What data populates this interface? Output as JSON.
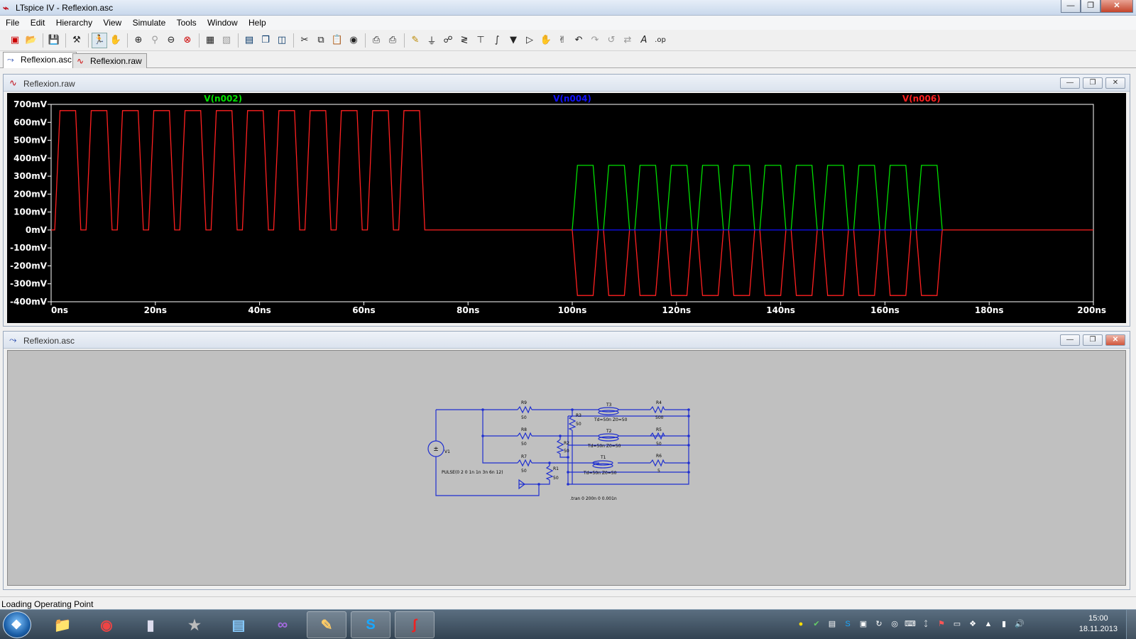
{
  "window": {
    "title": "LTspice IV - Reflexion.asc"
  },
  "menu": [
    "File",
    "Edit",
    "Hierarchy",
    "View",
    "Simulate",
    "Tools",
    "Window",
    "Help"
  ],
  "doc_tabs": [
    {
      "label": "Reflexion.asc",
      "active": true
    },
    {
      "label": "Reflexion.raw",
      "active": false
    }
  ],
  "plot_window": {
    "title": "Reflexion.raw",
    "traces": [
      {
        "name": "V(n002)",
        "color": "#00e000"
      },
      {
        "name": "V(n004)",
        "color": "#1010ff"
      },
      {
        "name": "V(n006)",
        "color": "#ff2020"
      }
    ]
  },
  "chart_data": {
    "type": "line",
    "xlabel": "",
    "ylabel": "",
    "x_ticks": [
      "0ns",
      "20ns",
      "40ns",
      "60ns",
      "80ns",
      "100ns",
      "120ns",
      "140ns",
      "160ns",
      "180ns",
      "200ns"
    ],
    "y_ticks": [
      "700mV",
      "600mV",
      "500mV",
      "400mV",
      "300mV",
      "200mV",
      "100mV",
      "0mV",
      "-100mV",
      "-200mV",
      "-300mV",
      "-400mV"
    ],
    "xlim": [
      0,
      200
    ],
    "ylim": [
      -400,
      700
    ],
    "grid": false,
    "series": [
      {
        "name": "V(n002)",
        "color": "#00e000",
        "description_pulses": {
          "start_ns": 100,
          "period_ns": 6,
          "count": 12,
          "high_mV": 360,
          "low_mV": 0,
          "rise_ns": 1,
          "width_ns": 3,
          "fall_ns": 1
        }
      },
      {
        "name": "V(n004)",
        "color": "#1010ff",
        "flat": {
          "from_ns": 100,
          "to_ns": 200,
          "value_mV": 0
        }
      },
      {
        "name": "V(n006)",
        "color": "#ff2020",
        "pulses_pos": {
          "start_ns": 0.7,
          "period_ns": 6,
          "count": 12,
          "high_mV": 665,
          "low_mV": 0,
          "rise_ns": 1,
          "width_ns": 3,
          "fall_ns": 1
        },
        "pulses_neg": {
          "start_ns": 100,
          "period_ns": 6,
          "count": 12,
          "high_mV": 0,
          "low_mV": -365,
          "rise_ns": 1,
          "width_ns": 3,
          "fall_ns": 1
        }
      }
    ]
  },
  "schematic_window": {
    "title": "Reflexion.asc",
    "labels": {
      "r9": "R9",
      "r9v": "50",
      "r8": "R8",
      "r8v": "50",
      "r7": "R7",
      "r7v": "50",
      "r3": "R3",
      "r3v": "50",
      "r2": "R2",
      "r2v": "50",
      "r1": "R1",
      "r1v": "50",
      "t3": "T3",
      "t3p": "Td=50n Z0=50",
      "t2": "T2",
      "t2p": "Td=50n Z0=50",
      "t1": "T1",
      "t1p": "Td=50n Z0=50",
      "r4": "R4",
      "r4v": "500",
      "r5": "R5",
      "r5v": "50",
      "r6": "R6",
      "r6v": "5",
      "v1": "V1",
      "v1p": "PULSE(0 2 0 1n 1n 3n 6n 12)",
      "tran": ".tran 0 200n 0 0.001n"
    }
  },
  "status": {
    "text": "Loading Operating Point"
  },
  "taskbar": {
    "time": "15:00",
    "date": "18.11.2013"
  }
}
